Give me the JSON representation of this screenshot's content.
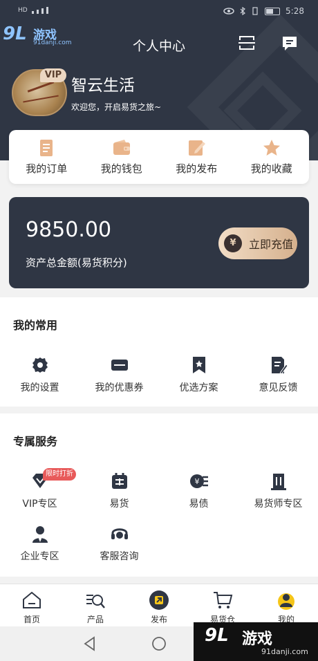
{
  "status_bar": {
    "carrier": "HD",
    "time": "5:28"
  },
  "watermark": {
    "logo": "9L",
    "text": "游戏",
    "url": "91danji.com"
  },
  "header": {
    "title": "个人中心",
    "scan_icon": "scan-icon",
    "message_icon": "message-icon"
  },
  "profile": {
    "vip_badge": "VIP",
    "name": "智云生活",
    "subtitle": "欢迎您，开启易货之旅~"
  },
  "quick_links": [
    {
      "label": "我的订单",
      "icon": "order-icon"
    },
    {
      "label": "我的钱包",
      "icon": "wallet-icon"
    },
    {
      "label": "我的发布",
      "icon": "publish-icon"
    },
    {
      "label": "我的收藏",
      "icon": "star-icon"
    }
  ],
  "asset": {
    "value": "9850.00",
    "label": "资产总金额(易货积分)",
    "recharge_label": "立即充值",
    "yen_symbol": "¥"
  },
  "common": {
    "title": "我的常用",
    "items": [
      {
        "label": "我的设置",
        "icon": "gear-icon"
      },
      {
        "label": "我的优惠券",
        "icon": "coupon-icon"
      },
      {
        "label": "优选方案",
        "icon": "bookmark-icon"
      },
      {
        "label": "意见反馈",
        "icon": "feedback-icon"
      }
    ]
  },
  "services": {
    "title": "专属服务",
    "tag": "限时打折",
    "items": [
      {
        "label": "VIP专区",
        "icon": "diamond-icon"
      },
      {
        "label": "易货",
        "icon": "exchange-icon"
      },
      {
        "label": "易债",
        "icon": "debt-icon"
      },
      {
        "label": "易货师专区",
        "icon": "building-icon"
      },
      {
        "label": "企业专区",
        "icon": "enterprise-icon"
      },
      {
        "label": "客服咨询",
        "icon": "headset-icon"
      }
    ]
  },
  "tabbar": [
    {
      "label": "首页",
      "icon": "home-icon"
    },
    {
      "label": "产品",
      "icon": "product-icon"
    },
    {
      "label": "发布",
      "icon": "publish-icon"
    },
    {
      "label": "易货仓",
      "icon": "cart-icon"
    },
    {
      "label": "我的",
      "icon": "profile-icon"
    }
  ],
  "colors": {
    "dark": "#2f3644",
    "gold": "#e0a679",
    "accent": "#f5c518",
    "tag": "#e85a5a"
  }
}
